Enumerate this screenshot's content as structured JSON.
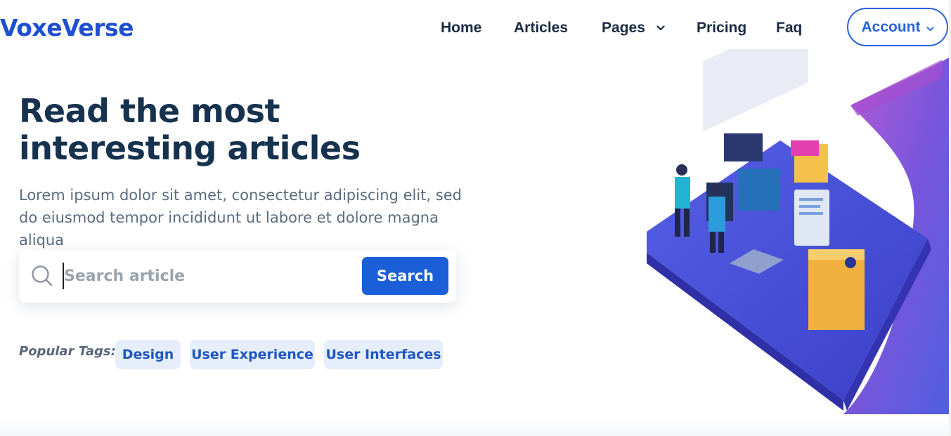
{
  "brand": {
    "name": "VoxeVerse"
  },
  "nav": {
    "items": [
      {
        "label": "Home"
      },
      {
        "label": "Articles"
      },
      {
        "label": "Pages"
      },
      {
        "label": "Pricing"
      },
      {
        "label": "Faq"
      }
    ],
    "account_label": "Account"
  },
  "hero": {
    "title": "Read the most interesting articles",
    "subtitle": "Lorem ipsum dolor sit amet, consectetur adipiscing elit, sed do eiusmod tempor incididunt ut labore et dolore magna aliqua"
  },
  "search": {
    "placeholder": "Search article",
    "value": "",
    "button_label": "Search"
  },
  "tags": {
    "label": "Popular Tags:",
    "items": [
      {
        "label": "Design"
      },
      {
        "label": "User Experience"
      },
      {
        "label": "User Interfaces"
      }
    ]
  },
  "colors": {
    "brand": "#1f4fd1",
    "heading": "#16324f",
    "primary_button": "#1b5fd8",
    "tag_bg": "#e6eefb",
    "tag_text": "#1f56c4",
    "illustration_purple": "#6a4fd6"
  },
  "icons": {
    "search": "search-icon",
    "pages_dropdown": "chevron-down-icon",
    "account_dropdown": "chevron-down-icon"
  }
}
